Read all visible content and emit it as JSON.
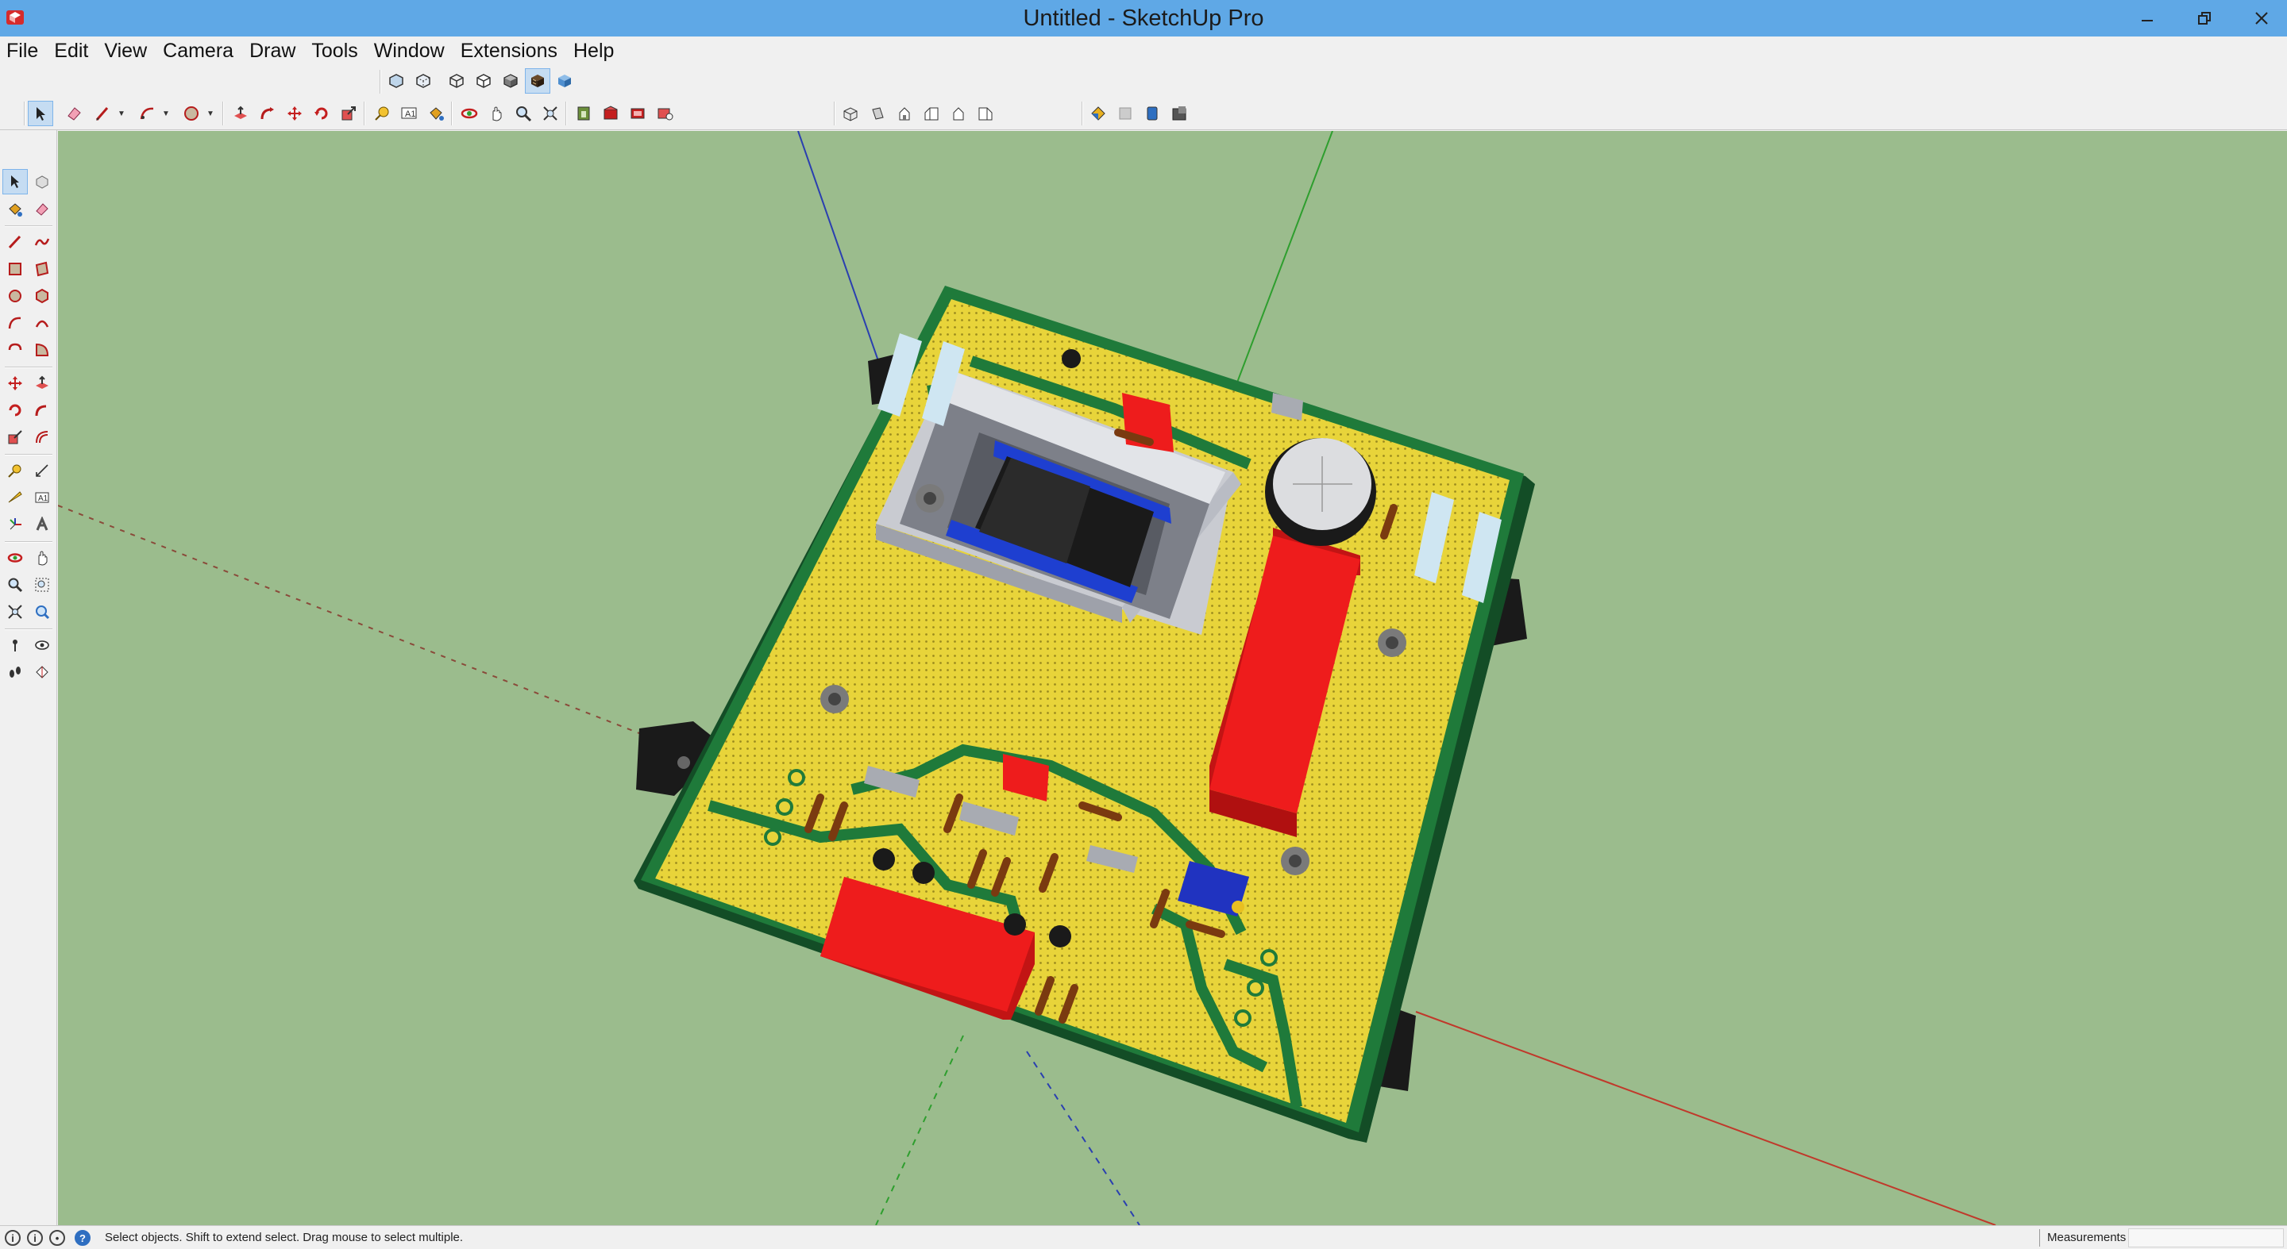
{
  "window": {
    "title": "Untitled - SketchUp Pro"
  },
  "menu": {
    "items": [
      "File",
      "Edit",
      "View",
      "Camera",
      "Draw",
      "Tools",
      "Window",
      "Extensions",
      "Help"
    ]
  },
  "toolbars": {
    "views": [
      "iso-view-icon",
      "top-view-icon",
      "front-view-icon",
      "right-view-icon",
      "back-view-icon",
      "left-view-icon"
    ],
    "styles": [
      "xray-style-icon",
      "back-edges-style-icon",
      "wireframe-style-icon",
      "hidden-line-style-icon",
      "shaded-style-icon",
      "shaded-textures-style-icon",
      "monochrome-style-icon"
    ],
    "active_style_index": 5
  },
  "statusbar": {
    "message": "Select objects. Shift to extend select. Drag mouse to select multiple.",
    "measurements_label": "Measurements",
    "measurements_value": ""
  },
  "colors": {
    "titlebar": "#5fa8e6",
    "viewport_bg": "#9bbc8d",
    "pcb_green": "#1f7a3a",
    "pcb_yellow": "#e8d43a",
    "component_red": "#ee1c1c",
    "axis_red": "#c0392b",
    "axis_green": "#2e9e2e",
    "axis_blue": "#2a3fb0"
  }
}
